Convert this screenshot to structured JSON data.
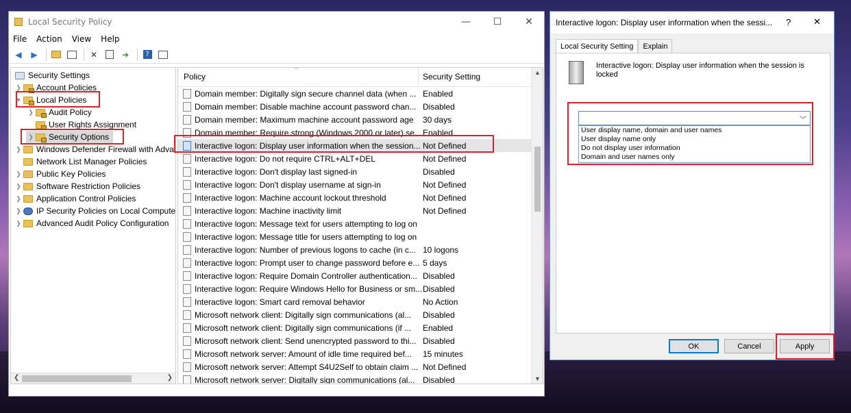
{
  "main_window": {
    "title": "Local Security Policy",
    "menu": [
      "File",
      "Action",
      "View",
      "Help"
    ],
    "tree": [
      {
        "label": "Security Settings",
        "level": 0,
        "expander": ""
      },
      {
        "label": "Account Policies",
        "level": 1,
        "expander": ">"
      },
      {
        "label": "Local Policies",
        "level": 1,
        "expander": "v"
      },
      {
        "label": "Audit Policy",
        "level": 2,
        "expander": ">"
      },
      {
        "label": "User Rights Assignment",
        "level": 2,
        "expander": ""
      },
      {
        "label": "Security Options",
        "level": 2,
        "expander": ">"
      },
      {
        "label": "Windows Defender Firewall with Adva",
        "level": 1,
        "expander": ">"
      },
      {
        "label": "Network List Manager Policies",
        "level": 1,
        "expander": ""
      },
      {
        "label": "Public Key Policies",
        "level": 1,
        "expander": ">"
      },
      {
        "label": "Software Restriction Policies",
        "level": 1,
        "expander": ">"
      },
      {
        "label": "Application Control Policies",
        "level": 1,
        "expander": ">"
      },
      {
        "label": "IP Security Policies on Local Compute",
        "level": 1,
        "expander": ">"
      },
      {
        "label": "Advanced Audit Policy Configuration",
        "level": 1,
        "expander": ">"
      }
    ],
    "columns": {
      "policy": "Policy",
      "setting": "Security Setting"
    },
    "rows": [
      {
        "policy": "Domain member: Digitally sign secure channel data (when ...",
        "setting": "Enabled"
      },
      {
        "policy": "Domain member: Disable machine account password chan...",
        "setting": "Disabled"
      },
      {
        "policy": "Domain member: Maximum machine account password age",
        "setting": "30 days"
      },
      {
        "policy": "Domain member: Require strong (Windows 2000 or later) se...",
        "setting": "Enabled"
      },
      {
        "policy": "Interactive logon: Display user information when the session...",
        "setting": "Not Defined"
      },
      {
        "policy": "Interactive logon: Do not require CTRL+ALT+DEL",
        "setting": "Not Defined"
      },
      {
        "policy": "Interactive logon: Don't display last signed-in",
        "setting": "Disabled"
      },
      {
        "policy": "Interactive logon: Don't display username at sign-in",
        "setting": "Not Defined"
      },
      {
        "policy": "Interactive logon: Machine account lockout threshold",
        "setting": "Not Defined"
      },
      {
        "policy": "Interactive logon: Machine inactivity limit",
        "setting": "Not Defined"
      },
      {
        "policy": "Interactive logon: Message text for users attempting to log on",
        "setting": ""
      },
      {
        "policy": "Interactive logon: Message title for users attempting to log on",
        "setting": ""
      },
      {
        "policy": "Interactive logon: Number of previous logons to cache (in c...",
        "setting": "10 logons"
      },
      {
        "policy": "Interactive logon: Prompt user to change password before e...",
        "setting": "5 days"
      },
      {
        "policy": "Interactive logon: Require Domain Controller authentication...",
        "setting": "Disabled"
      },
      {
        "policy": "Interactive logon: Require Windows Hello for Business or sm...",
        "setting": "Disabled"
      },
      {
        "policy": "Interactive logon: Smart card removal behavior",
        "setting": "No Action"
      },
      {
        "policy": "Microsoft network client: Digitally sign communications (al...",
        "setting": "Disabled"
      },
      {
        "policy": "Microsoft network client: Digitally sign communications (if ...",
        "setting": "Enabled"
      },
      {
        "policy": "Microsoft network client: Send unencrypted password to thi...",
        "setting": "Disabled"
      },
      {
        "policy": "Microsoft network server: Amount of idle time required bef...",
        "setting": "15 minutes"
      },
      {
        "policy": "Microsoft network server: Attempt S4U2Self to obtain claim ...",
        "setting": "Not Defined"
      },
      {
        "policy": "Microsoft network server: Digitally sign communications (al...",
        "setting": "Disabled"
      }
    ]
  },
  "dialog": {
    "title": "Interactive logon: Display user information when the sessi...",
    "help": "?",
    "close": "✕",
    "tabs": [
      "Local Security Setting",
      "Explain"
    ],
    "description": "Interactive logon: Display user information when the session is locked",
    "combo_value": "",
    "options": [
      "User display name, domain and user names",
      "User display name only",
      "Do not display user information",
      "Domain and user names only"
    ],
    "buttons": {
      "ok": "OK",
      "cancel": "Cancel",
      "apply": "Apply"
    }
  }
}
